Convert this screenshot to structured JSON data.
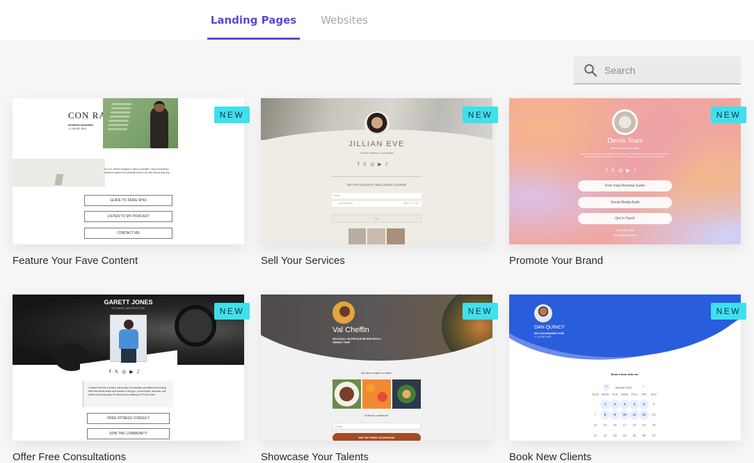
{
  "tabs": [
    {
      "label": "Landing Pages",
      "active": true
    },
    {
      "label": "Websites",
      "active": false
    }
  ],
  "search": {
    "placeholder": "Search",
    "value": "",
    "icon": "search-icon"
  },
  "badge_color": "#3fe0ee",
  "accent_color": "#5b45e0",
  "templates": [
    {
      "caption": "Feature Your Fave Content",
      "badge": "NEW",
      "preview": {
        "name": "CON RAD",
        "subtitle": "INTERIOR DESIGNER",
        "phone": "+1 234 567 8901",
        "bio": "I'm Con, Interior Designer & space consultant. I help homeowners transform spaces into functional works of art with various feng shui",
        "buttons": [
          "GUIDE TO FENG SHUI",
          "LISTEN TO MY PODCAST",
          "CONTACT ME"
        ]
      }
    },
    {
      "caption": "Sell Your Services",
      "badge": "NEW",
      "preview": {
        "name": "JILLIAN EVE",
        "subtitle": "holistic wellness consultant",
        "heading": "GET MY HOLISTIC WELLNESS COURSE",
        "email_placeholder": "Email",
        "card_placeholder": "Card number",
        "card_extra": "MM / YY  CVC",
        "pay_label": "Pay"
      }
    },
    {
      "caption": "Promote Your Brand",
      "badge": "NEW",
      "preview": {
        "name": "Devin Starr",
        "subtitle": "social media consultant",
        "bio": "Hey there! I'm Devin Starr, a social media consultant. I've helped brands boost their following by 3.5k. Check out my resources to see how I can help your social engagement skyrocket!",
        "buttons": [
          "Free Insta Revamp Guide",
          "Social Media Audit",
          "Get In Touch"
        ],
        "phone": "+1 234 567 8901",
        "email": "myemail@email.com"
      }
    },
    {
      "caption": "Offer Free Consultations",
      "badge": "NEW",
      "preview": {
        "name": "GARETT JONES",
        "subtitle": "FITNESS INSTRUCTOR",
        "bio": "I created GetTrue to build a community of individuals committed to becoming their best selves inside and outside of the gym. I post recipes, workouts, and advice to my blog daily. So what are you waiting for? It's your time.",
        "buttons": [
          "FREE FITNESS CONSULT",
          "JOIN THE COMMUNITY"
        ]
      }
    },
    {
      "caption": "Showcase Your Talents",
      "badge": "NEW",
      "preview": {
        "name": "Val Cheffin",
        "subtitle": "DELICIOUS + NUTRITIOUS RECIPES WITH A VIBRANT TWIST",
        "recipes_label": "My fave recipes on Insta:",
        "cookbook_label": "Grab my cookbook:",
        "email_placeholder": "Email",
        "cta": "GET MY FREE COOKBOOK"
      }
    },
    {
      "caption": "Book New Clients",
      "badge": "NEW",
      "preview": {
        "name": "DAN QUINCY",
        "email": "HELLO@DANQUINCY.COM",
        "phone": "+1 234 567 8901",
        "heading": "Book a time with me:",
        "month": "January 2024",
        "weekdays": [
          "SUN",
          "MON",
          "TUE",
          "WED",
          "THU",
          "FRI",
          "SAT"
        ],
        "days": [
          "",
          "1",
          "2",
          "3",
          "4",
          "5",
          "6",
          "7",
          "8",
          "9",
          "10",
          "11",
          "12",
          "13",
          "14",
          "15",
          "16",
          "17",
          "18",
          "19",
          "20",
          "21",
          "22",
          "23",
          "24",
          "25",
          "26",
          "27"
        ],
        "available_days": [
          "1",
          "2",
          "3",
          "4",
          "5",
          "8",
          "9",
          "10",
          "11",
          "12"
        ]
      }
    }
  ]
}
